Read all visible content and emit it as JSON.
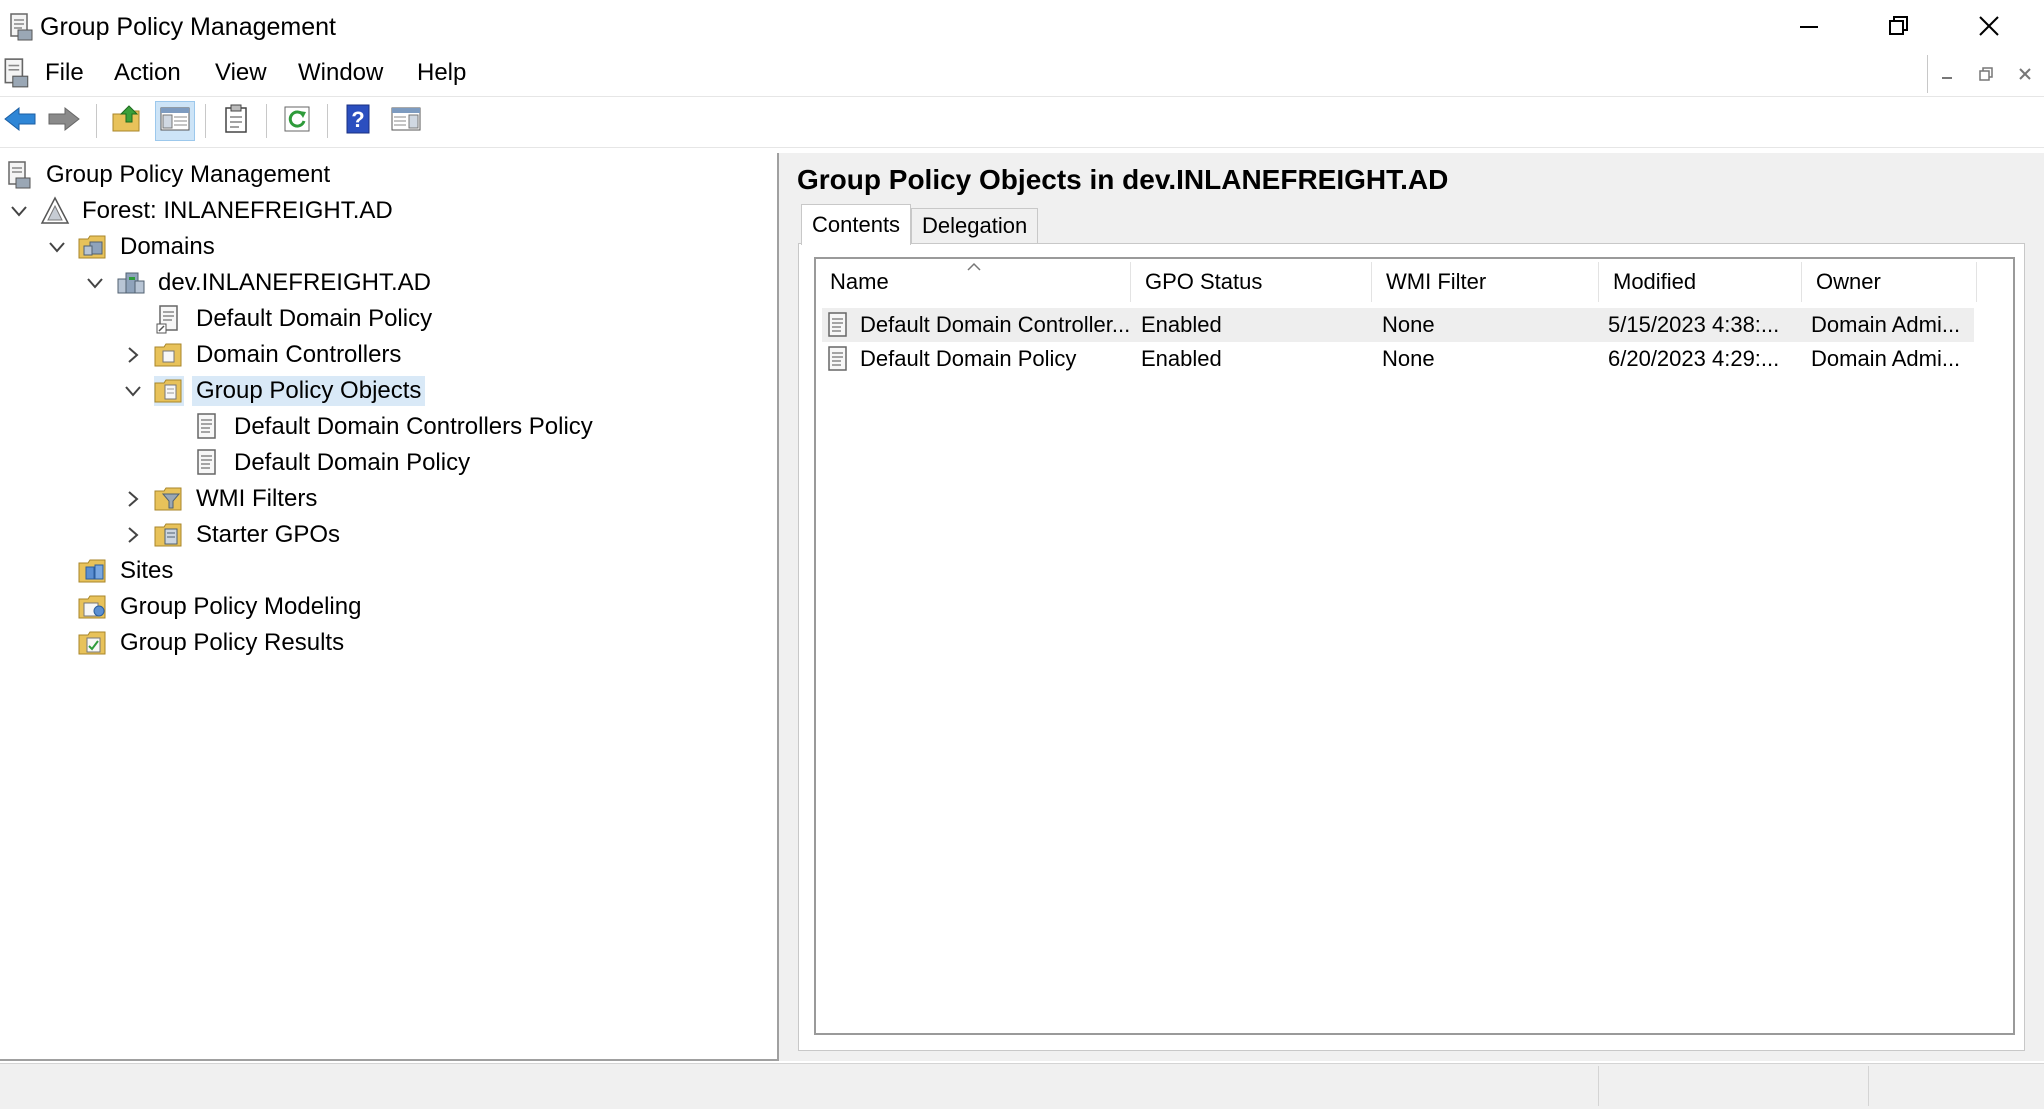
{
  "window": {
    "title": "Group Policy Management"
  },
  "menu": {
    "items": [
      "File",
      "Action",
      "View",
      "Window",
      "Help"
    ]
  },
  "toolbar": {
    "buttons": [
      "back-arrow-icon",
      "forward-arrow-icon",
      "up-folder-icon",
      "show-hide-tree-icon",
      "properties-icon",
      "refresh-icon",
      "help-icon",
      "show-hide-action-pane-icon"
    ]
  },
  "tree": {
    "root": "Group Policy Management",
    "forest": "Forest: INLANEFREIGHT.AD",
    "domains": "Domains",
    "domain": "dev.INLANEFREIGHT.AD",
    "default_domain_policy": "Default Domain Policy",
    "domain_controllers": "Domain Controllers",
    "gpo_container": "Group Policy Objects",
    "gpo_ddcp": "Default Domain Controllers Policy",
    "gpo_ddp": "Default Domain Policy",
    "wmi_filters": "WMI Filters",
    "starter_gpos": "Starter GPOs",
    "sites": "Sites",
    "modeling": "Group Policy Modeling",
    "results": "Group Policy Results"
  },
  "details": {
    "title": "Group Policy Objects in dev.INLANEFREIGHT.AD",
    "tabs": [
      "Contents",
      "Delegation"
    ],
    "columns": [
      "Name",
      "GPO Status",
      "WMI Filter",
      "Modified",
      "Owner"
    ],
    "rows": [
      {
        "name": "Default Domain Controller...",
        "status": "Enabled",
        "wmi": "None",
        "modified": "5/15/2023 4:38:...",
        "owner": "Domain Admi..."
      },
      {
        "name": "Default Domain Policy",
        "status": "Enabled",
        "wmi": "None",
        "modified": "6/20/2023 4:29:...",
        "owner": "Domain Admi..."
      }
    ]
  },
  "colors": {
    "selection": "#d9e9f7",
    "chrome": "#f0f0f0",
    "accent_blue": "#1f6fd1",
    "folder": "#e8c25a"
  }
}
